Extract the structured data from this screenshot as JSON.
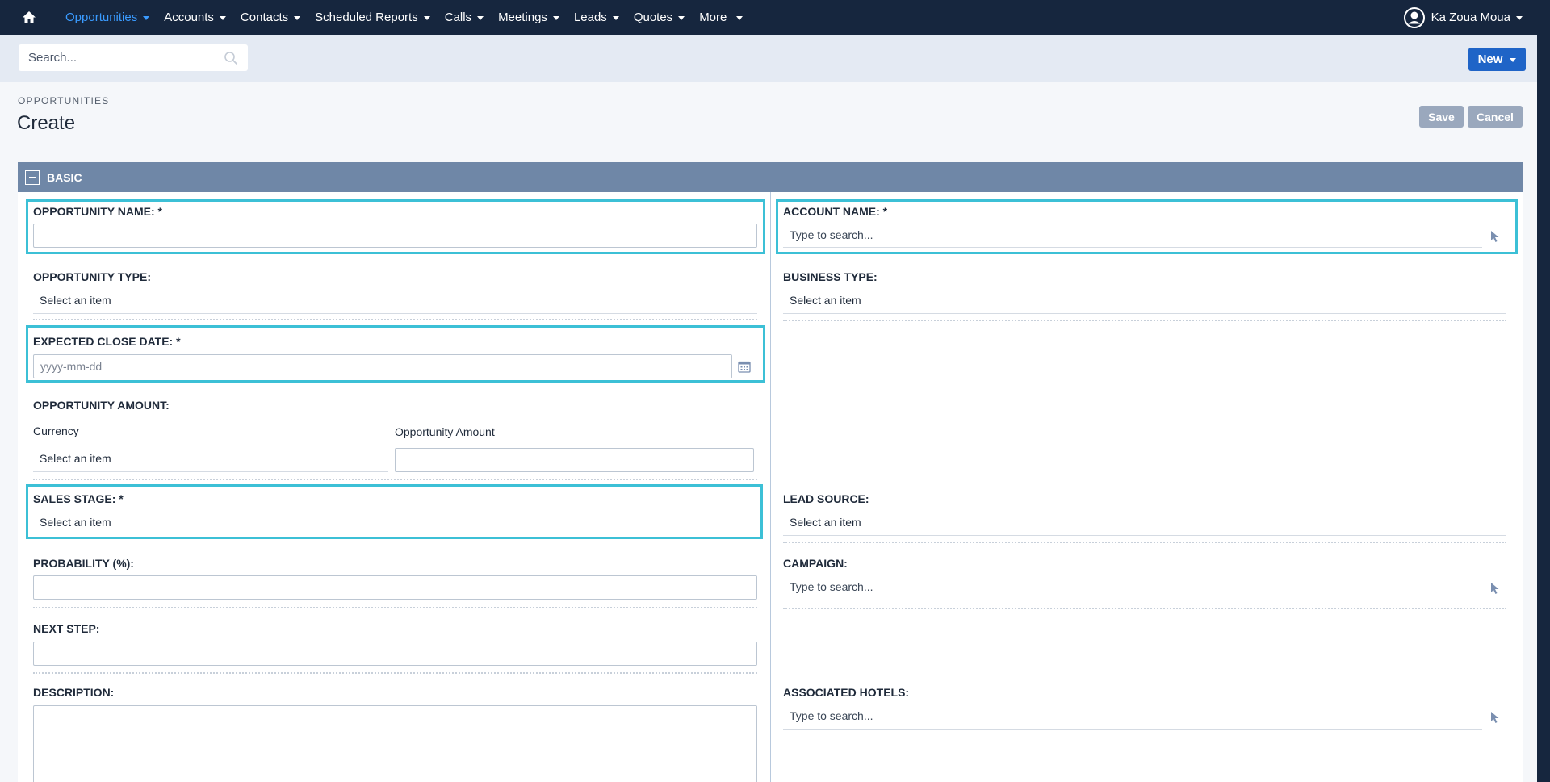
{
  "nav": {
    "items": [
      {
        "label": "Opportunities",
        "active": true
      },
      {
        "label": "Accounts"
      },
      {
        "label": "Contacts"
      },
      {
        "label": "Scheduled Reports"
      },
      {
        "label": "Calls"
      },
      {
        "label": "Meetings"
      },
      {
        "label": "Leads"
      },
      {
        "label": "Quotes"
      },
      {
        "label": "More"
      }
    ],
    "user_name": "Ka Zoua Moua"
  },
  "search": {
    "placeholder": "Search..."
  },
  "toolbar": {
    "new_label": "New",
    "save_label": "Save",
    "cancel_label": "Cancel"
  },
  "header": {
    "module": "OPPORTUNITIES",
    "title": "Create"
  },
  "panel": {
    "title": "BASIC"
  },
  "form": {
    "opportunity_name": {
      "label": "OPPORTUNITY NAME: *",
      "value": ""
    },
    "account_name": {
      "label": "ACCOUNT NAME: *",
      "placeholder": "Type to search..."
    },
    "opportunity_type": {
      "label": "OPPORTUNITY TYPE:",
      "value": "Select an item"
    },
    "business_type": {
      "label": "BUSINESS TYPE:",
      "value": "Select an item"
    },
    "expected_close_date": {
      "label": "EXPECTED CLOSE DATE: *",
      "placeholder": "yyyy-mm-dd"
    },
    "opportunity_amount": {
      "label": "OPPORTUNITY AMOUNT:",
      "currency_label": "Currency",
      "currency_value": "Select an item",
      "amount_label": "Opportunity Amount",
      "amount_value": ""
    },
    "sales_stage": {
      "label": "SALES STAGE: *",
      "value": "Select an item"
    },
    "lead_source": {
      "label": "LEAD SOURCE:",
      "value": "Select an item"
    },
    "probability": {
      "label": "PROBABILITY (%):",
      "value": ""
    },
    "campaign": {
      "label": "CAMPAIGN:",
      "placeholder": "Type to search..."
    },
    "next_step": {
      "label": "NEXT STEP:",
      "value": ""
    },
    "description": {
      "label": "DESCRIPTION:",
      "value": ""
    },
    "associated_hotels": {
      "label": "ASSOCIATED HOTELS:",
      "placeholder": "Type to search..."
    }
  },
  "colors": {
    "nav_bg": "#16263e",
    "accent": "#3a9bff",
    "primary_btn": "#1f64c7",
    "panel_header": "#6f87a7",
    "highlight": "#3cc0d6",
    "disabled_btn": "#9aa8bd"
  },
  "icons": {
    "home": "home-icon",
    "search": "search-icon",
    "user": "user-avatar-icon",
    "calendar": "calendar-icon",
    "select_pointer": "cursor-pointer-icon"
  }
}
